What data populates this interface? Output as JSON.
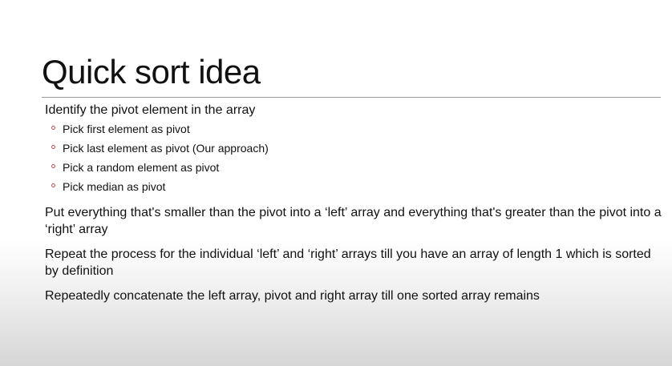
{
  "slide": {
    "title": "Quick sort idea",
    "points": [
      {
        "text": "Identify the pivot element in the array",
        "sub": [
          "Pick first element as pivot",
          "Pick last element as pivot (Our approach)",
          "Pick a random element as pivot",
          "Pick median as pivot"
        ]
      },
      {
        "text": "Put everything that's smaller than the pivot into a ‘left’ array and everything that's greater than the pivot into a ‘right’ array"
      },
      {
        "text": "Repeat the process for the individual ‘left’ and ‘right’ arrays till you have an array of length 1 which is sorted by definition"
      },
      {
        "text": "Repeatedly concatenate the left array, pivot and right array till one sorted array remains"
      }
    ]
  },
  "colors": {
    "bullet": "#c0504d",
    "rule": "#9a9a9a"
  }
}
